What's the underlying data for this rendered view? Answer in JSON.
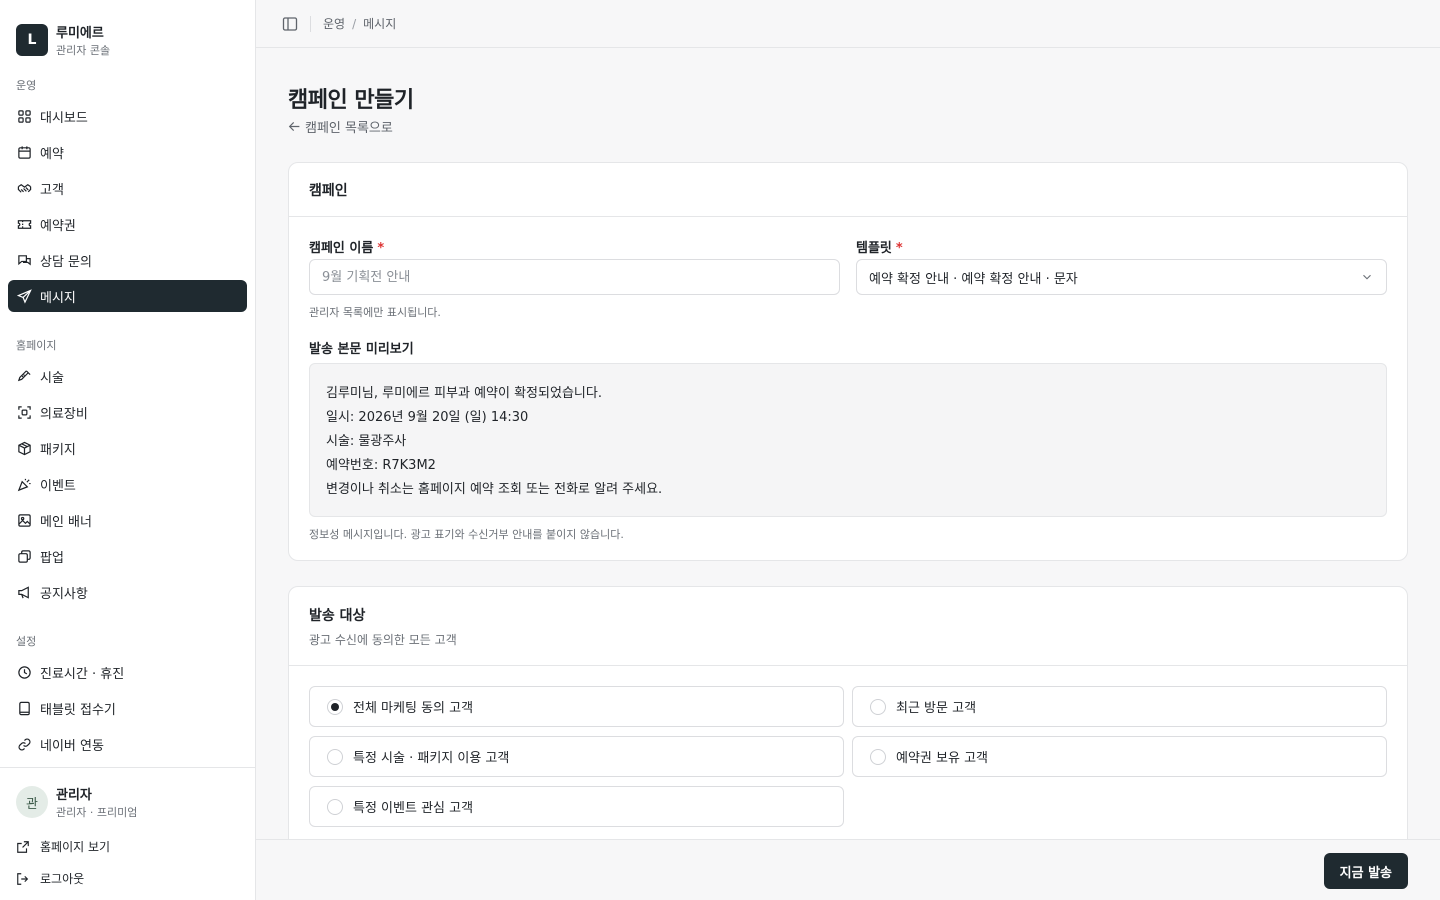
{
  "brand": {
    "logo": "L",
    "title": "루미에르",
    "subtitle": "관리자 콘솔"
  },
  "sidebar": {
    "sections": [
      {
        "label": "운영"
      },
      {
        "label": "홈페이지"
      },
      {
        "label": "설정"
      }
    ],
    "items": [
      {
        "label": "대시보드",
        "icon": "grid-icon"
      },
      {
        "label": "예약",
        "icon": "calendar-icon"
      },
      {
        "label": "고객",
        "icon": "handshake-icon"
      },
      {
        "label": "예약권",
        "icon": "ticket-icon"
      },
      {
        "label": "상담 문의",
        "icon": "chat-icon"
      },
      {
        "label": "메시지",
        "icon": "send-icon",
        "active": true
      },
      {
        "label": "시술",
        "icon": "syringe-icon"
      },
      {
        "label": "의료장비",
        "icon": "scan-icon"
      },
      {
        "label": "패키지",
        "icon": "package-icon"
      },
      {
        "label": "이벤트",
        "icon": "party-icon"
      },
      {
        "label": "메인 배너",
        "icon": "image-icon"
      },
      {
        "label": "팝업",
        "icon": "layers-icon"
      },
      {
        "label": "공지사항",
        "icon": "megaphone-icon"
      },
      {
        "label": "진료시간 · 휴진",
        "icon": "clock-icon"
      },
      {
        "label": "태블릿 접수기",
        "icon": "tablet-icon"
      },
      {
        "label": "네이버 연동",
        "icon": "link-icon"
      }
    ]
  },
  "user": {
    "avatar": "관",
    "name": "관리자",
    "role": "관리자 · 프리미엄"
  },
  "footer_links": {
    "homepage": "홈페이지 보기",
    "logout": "로그아웃"
  },
  "breadcrumb": {
    "parent": "운영",
    "sep": "/",
    "current": "메시지"
  },
  "page": {
    "title": "캠페인 만들기",
    "back": "캠페인 목록으로"
  },
  "campaign_card": {
    "title": "캠페인",
    "name_label": "캠페인 이름",
    "name_placeholder": "9월 기획전 안내",
    "name_value": "",
    "name_help": "관리자 목록에만 표시됩니다.",
    "template_label": "템플릿",
    "template_value": "예약 확정 안내 · 예약 확정 안내 · 문자",
    "required_mark": "*",
    "preview_label": "발송 본문 미리보기",
    "preview_lines": [
      "김루미님, 루미에르 피부과 예약이 확정되었습니다.",
      "일시: 2026년 9월 20일 (일) 14:30",
      "시술: 물광주사",
      "예약번호: R7K3M2",
      "변경이나 취소는 홈페이지 예약 조회 또는 전화로 알려 주세요."
    ],
    "preview_help": "정보성 메시지입니다. 광고 표기와 수신거부 안내를 붙이지 않습니다."
  },
  "target_card": {
    "title": "발송 대상",
    "subtitle": "광고 수신에 동의한 모든 고객",
    "options": [
      {
        "label": "전체 마케팅 동의 고객",
        "checked": true
      },
      {
        "label": "최근 방문 고객",
        "checked": false
      },
      {
        "label": "특정 시술 · 패키지 이용 고객",
        "checked": false
      },
      {
        "label": "예약권 보유 고객",
        "checked": false
      },
      {
        "label": "특정 이벤트 관심 고객",
        "checked": false
      }
    ]
  },
  "actions": {
    "send_now": "지금 발송"
  }
}
